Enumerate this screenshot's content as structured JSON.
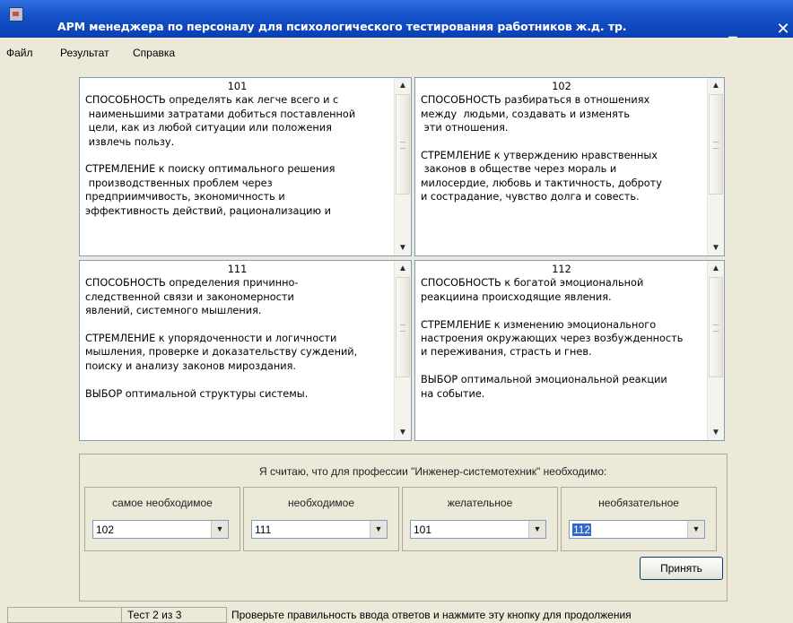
{
  "window": {
    "title": "АРМ менеджера по персоналу для психологического тестирования работников ж.д. тр.",
    "minimize": "_",
    "close": "✕"
  },
  "menu": [
    "Файл",
    "Результат",
    "Справка"
  ],
  "cards": [
    {
      "number": "101",
      "text": "СПОСОБНОСТЬ определять как легче всего и с\n наименьшими затратами добиться поставленной\n цели, как из любой ситуации или положения\n извлечь пользу.\n\nСТРЕМЛЕНИЕ к поиску оптимального решения\n производственных проблем через\nпредприимчивость, экономичность и\nэффективность действий, рационализацию и"
    },
    {
      "number": "102",
      "text": "СПОСОБНОСТЬ разбираться в отношениях\nмежду  людьми, создавать и изменять\n эти отношения.\n\nСТРЕМЛЕНИЕ к утверждению нравственных\n законов в обществе через мораль и\nмилосердие, любовь и тактичность, доброту\nи сострадание, чувство долга и совесть."
    },
    {
      "number": "111",
      "text": "СПОСОБНОСТЬ определения причинно-\nследственной связи и закономерности\nявлений, системного мышления.\n\nСТРЕМЛЕНИЕ к упорядоченности и логичности\nмышления, проверке и доказательству суждений,\nпоиску и анализу законов мироздания.\n\nВЫБОР оптимальной структуры системы."
    },
    {
      "number": "112",
      "text": "СПОСОБНОСТЬ к богатой эмоциональной\nреакциина происходящие явления.\n\nСТРЕМЛЕНИЕ к изменению эмоционального\nнастроения окружающих через возбужденность\nи переживания, страсть и гнев.\n\nВЫБОР оптимальной эмоциональной реакции\nна событие."
    }
  ],
  "prompt": "Я считаю, что для профессии \"Инженер-системотехник\" необходимо:",
  "groups": [
    {
      "label": "самое необходимое",
      "value": "102"
    },
    {
      "label": "необходимое",
      "value": "111"
    },
    {
      "label": "желательное",
      "value": "101"
    },
    {
      "label": "необязательное",
      "value": "112"
    }
  ],
  "accept_button": "Принять",
  "status": {
    "progress": "Тест 2 из 3",
    "hint": "Проверьте правильность ввода ответов и нажмите эту кнопку для продолжения"
  },
  "colors": {
    "titlebar": "#1450c8",
    "selection": "#316ac5",
    "window_bg": "#ece9d8"
  }
}
